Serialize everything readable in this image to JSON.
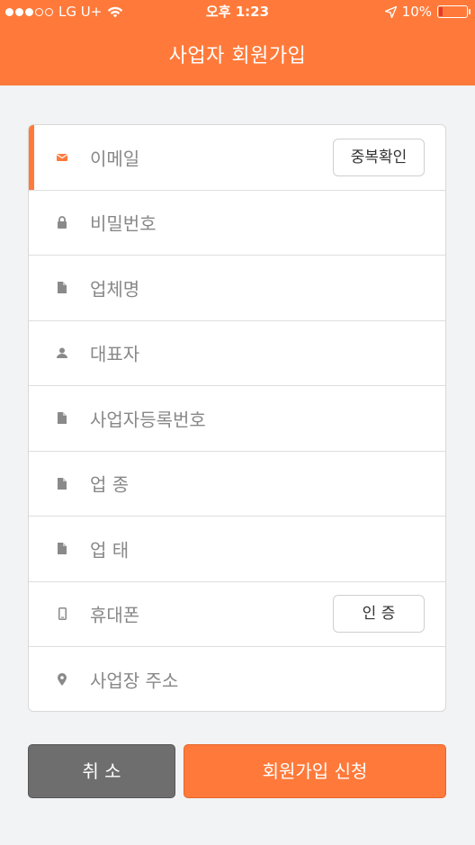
{
  "status_bar": {
    "carrier": "LG U+",
    "time": "오후 1:23",
    "battery": "10%"
  },
  "header": {
    "title": "사업자 회원가입"
  },
  "form": {
    "fields": [
      {
        "label": "이메일",
        "icon": "envelope-icon",
        "button": "중복확인"
      },
      {
        "label": "비밀번호",
        "icon": "lock-icon"
      },
      {
        "label": "업체명",
        "icon": "document-icon"
      },
      {
        "label": "대표자",
        "icon": "person-icon"
      },
      {
        "label": "사업자등록번호",
        "icon": "document-icon"
      },
      {
        "label": "업 종",
        "icon": "document-icon"
      },
      {
        "label": "업 태",
        "icon": "document-icon"
      },
      {
        "label": "휴대폰",
        "icon": "phone-icon",
        "button": "인 증"
      },
      {
        "label": "사업장 주소",
        "icon": "location-pin-icon"
      }
    ]
  },
  "actions": {
    "cancel": "취 소",
    "submit": "회원가입 신청"
  },
  "colors": {
    "accent": "#ff7a3a",
    "cancel_bg": "#6e6e6e",
    "page_bg": "#f2f3f5"
  }
}
